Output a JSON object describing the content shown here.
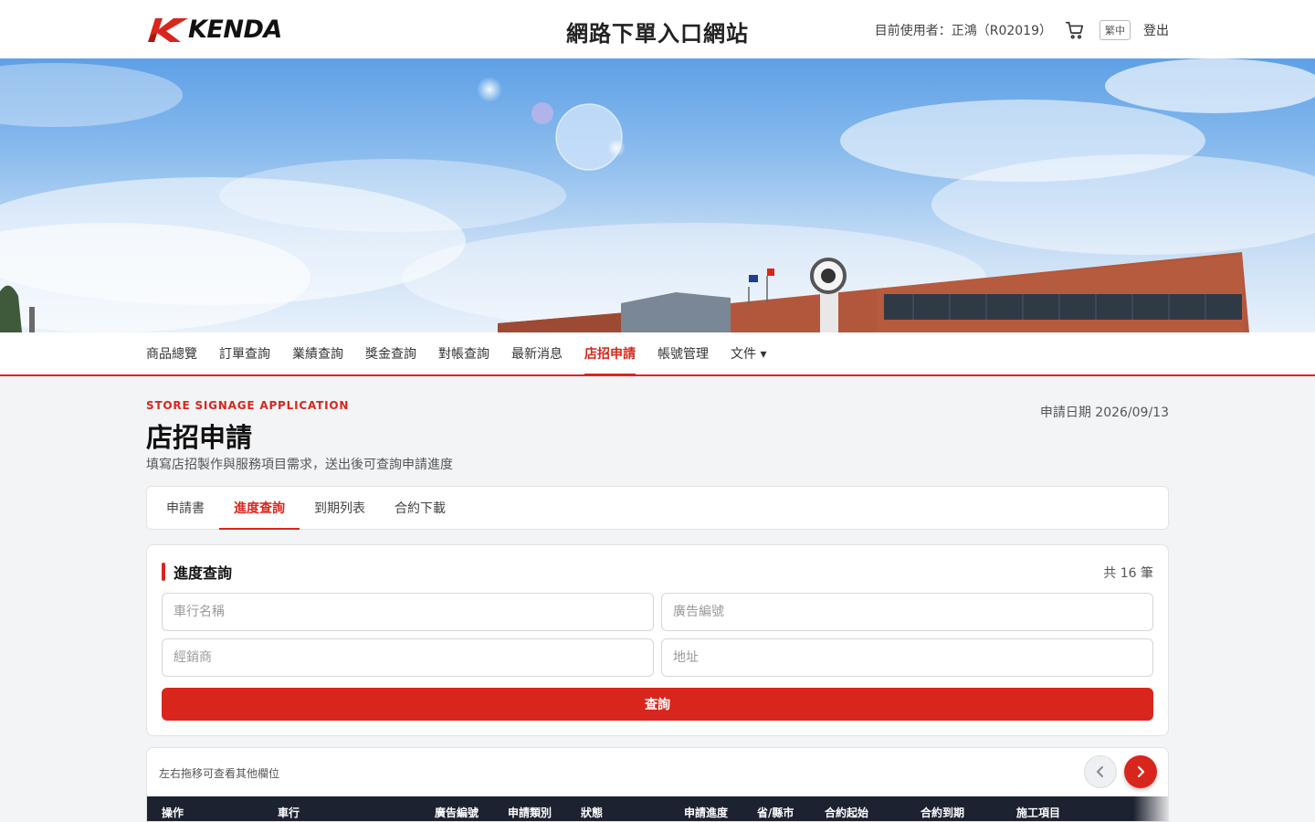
{
  "header": {
    "logo_text": "KENDA",
    "site_title": "網路下單入口網站",
    "user_label": "目前使用者：正鴻（R02019）",
    "cart_icon": "cart-icon",
    "lang_label": "繁中",
    "logout_label": "登出"
  },
  "nav": {
    "items": [
      {
        "label": "商品總覽"
      },
      {
        "label": "訂單查詢"
      },
      {
        "label": "業績查詢"
      },
      {
        "label": "獎金查詢"
      },
      {
        "label": "對帳查詢"
      },
      {
        "label": "最新消息"
      },
      {
        "label": "店招申請"
      },
      {
        "label": "帳號管理"
      },
      {
        "label": "文件 ▾"
      }
    ],
    "active_label": "店招申請"
  },
  "page": {
    "eyebrow": "STORE SIGNAGE APPLICATION",
    "title": "店招申請",
    "subtitle": "填寫店招製作與服務項目需求，送出後可查詢申請進度",
    "apply_date": "申請日期 2026/09/13"
  },
  "tabs": {
    "items": [
      {
        "label": "申請書"
      },
      {
        "label": "進度查詢"
      },
      {
        "label": "到期列表"
      },
      {
        "label": "合約下載"
      }
    ],
    "active_label": "進度查詢"
  },
  "search": {
    "title": "進度查詢",
    "count": "共 16 筆",
    "store_name_placeholder": "車行名稱",
    "ad_number_placeholder": "廣告編號",
    "dealer_placeholder": "經銷商",
    "address_placeholder": "地址",
    "submit_label": "查詢"
  },
  "table": {
    "hint": "左右拖移可查看其他欄位",
    "columns": [
      "操作",
      "車行",
      "廣告編號",
      "申請類別",
      "狀態",
      "申請進度",
      "省/縣市",
      "合約起始",
      "合約到期",
      "施工項目"
    ]
  },
  "colors": {
    "accent": "#d9261c",
    "table_header": "#1c2230"
  }
}
